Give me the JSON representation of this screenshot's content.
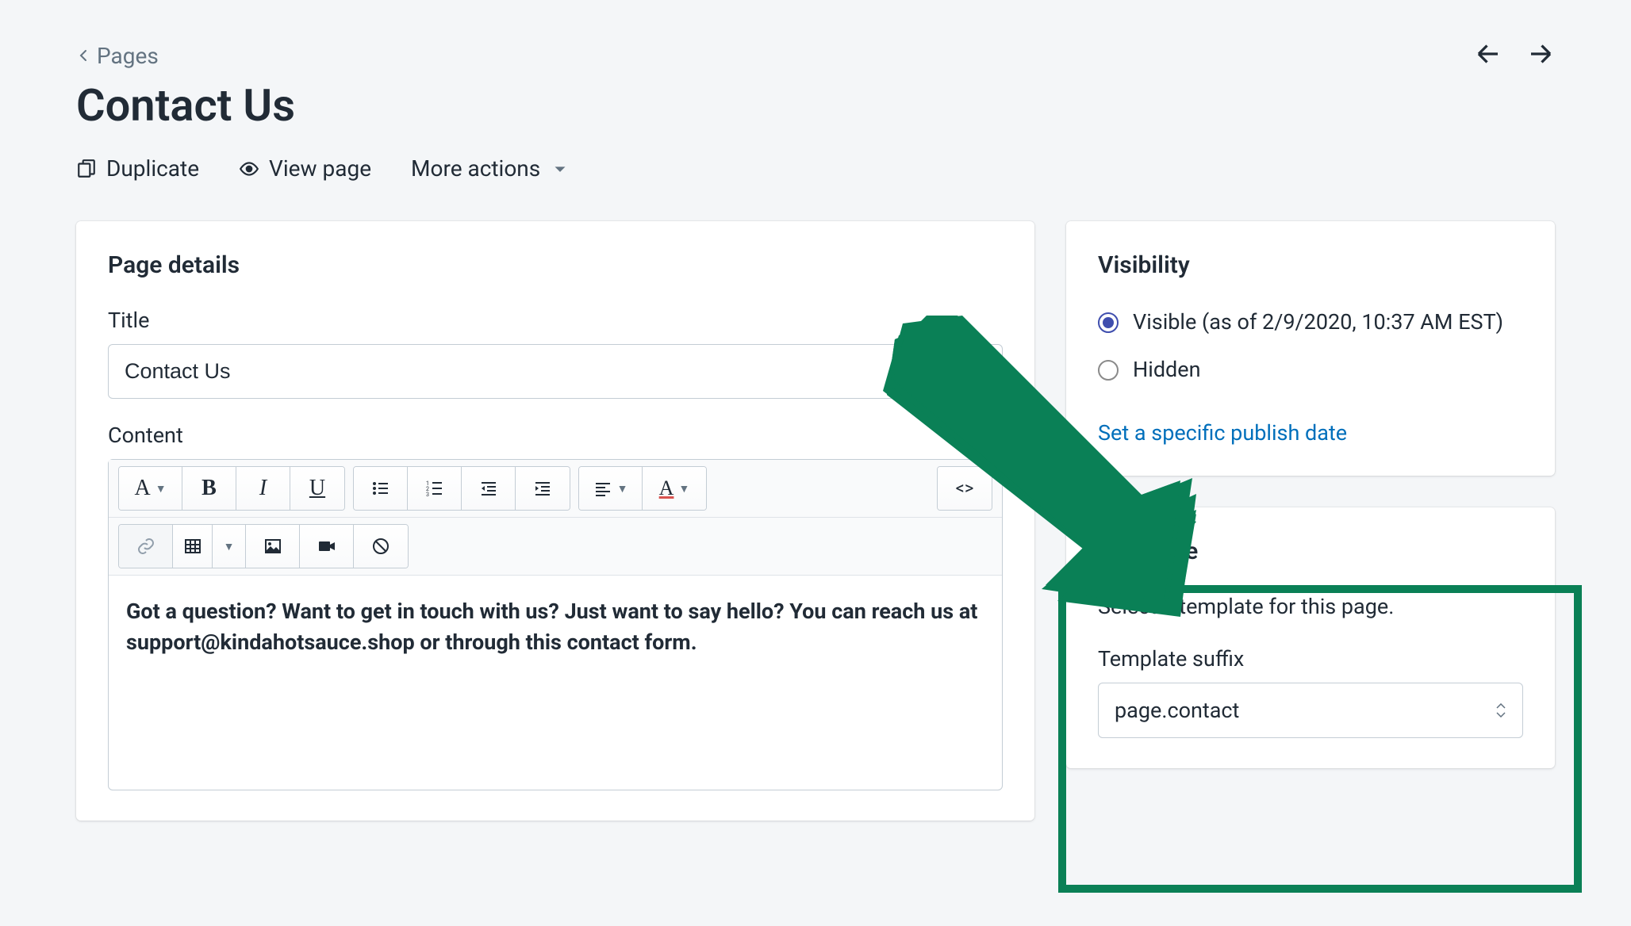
{
  "breadcrumb": {
    "label": "Pages"
  },
  "page_title": "Contact Us",
  "actions": {
    "duplicate": "Duplicate",
    "view": "View page",
    "more": "More actions"
  },
  "main": {
    "heading": "Page details",
    "title_label": "Title",
    "title_value": "Contact Us",
    "content_label": "Content",
    "content_body": "Got a question? Want to get in touch with us? Just want to say hello? You can reach us at support@kindahotsauce.shop or through this contact form."
  },
  "visibility": {
    "heading": "Visibility",
    "visible_label": "Visible (as of 2/9/2020, 10:37 AM EST)",
    "hidden_label": "Hidden",
    "set_date_link": "Set a specific publish date"
  },
  "template": {
    "heading": "Template",
    "help": "Select a template for this page.",
    "suffix_label": "Template suffix",
    "suffix_value": "page.contact"
  },
  "toolbar": {
    "font_letter": "A",
    "bold": "B",
    "italic": "I",
    "underline": "U",
    "html_label": "<>"
  }
}
